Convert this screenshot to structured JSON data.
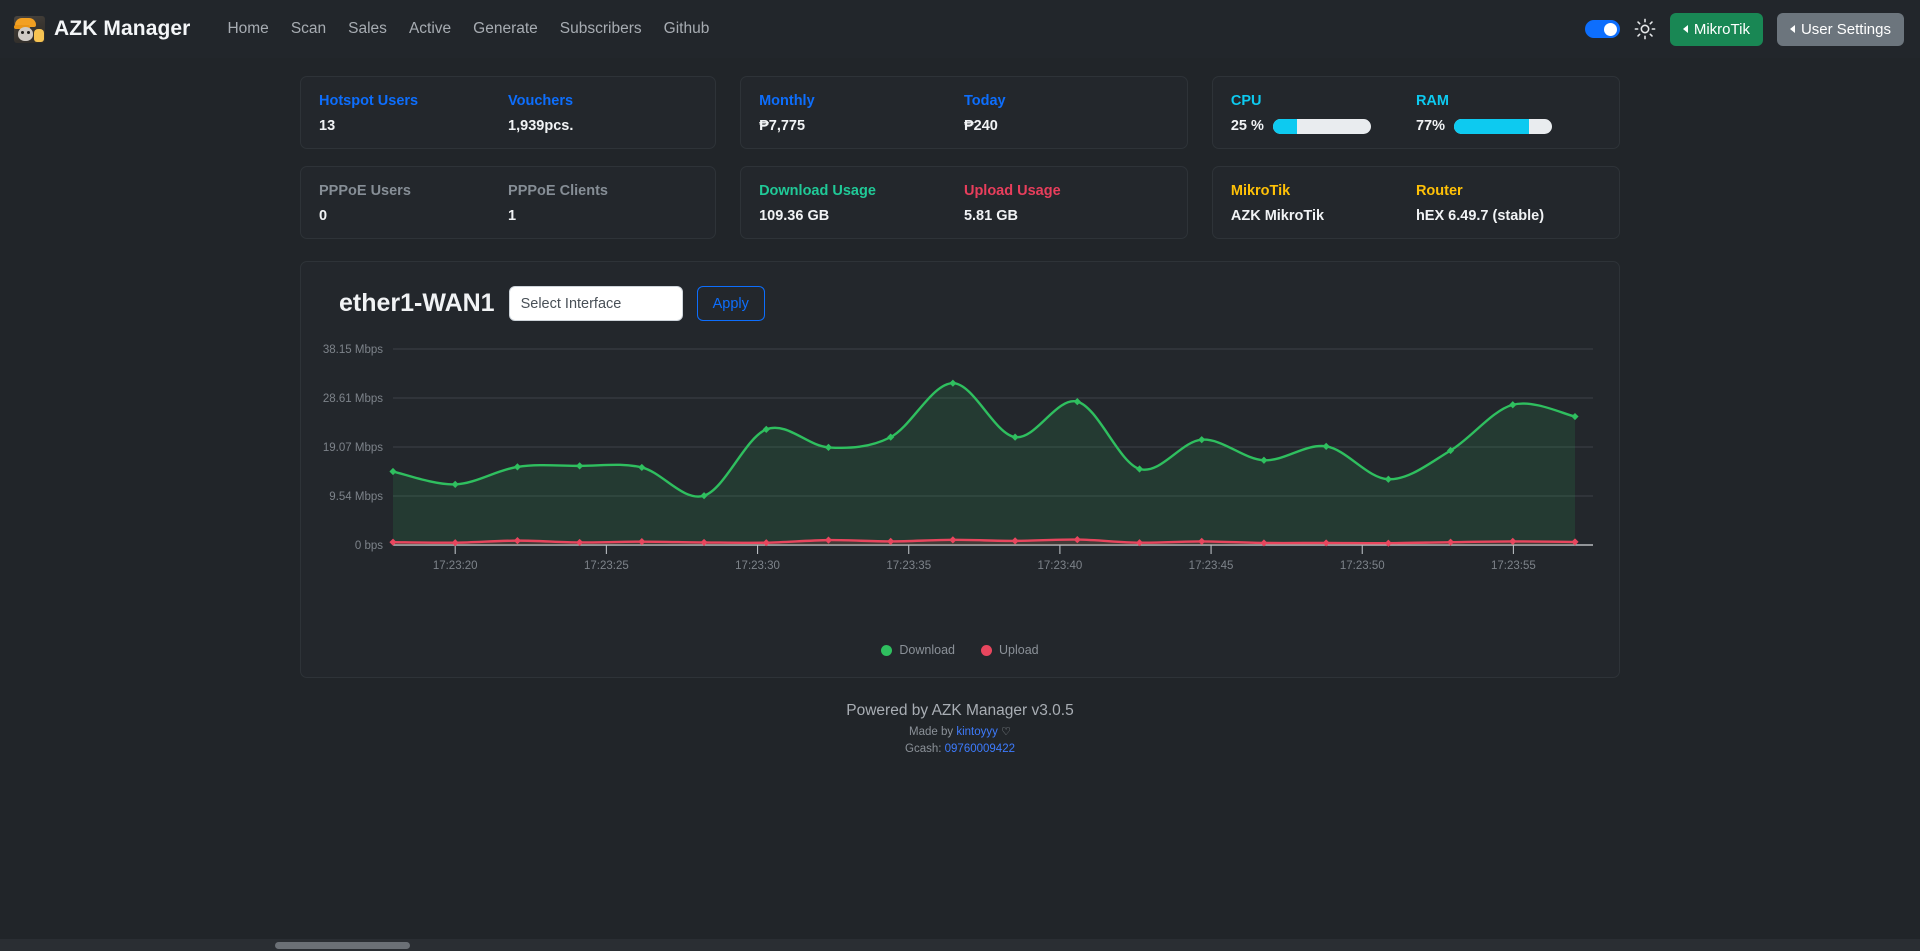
{
  "navbar": {
    "brand": "AZK Manager",
    "logo_icon": "azk-avatar-icon",
    "links": [
      {
        "label": "Home"
      },
      {
        "label": "Scan"
      },
      {
        "label": "Sales"
      },
      {
        "label": "Active"
      },
      {
        "label": "Generate"
      },
      {
        "label": "Subscribers"
      },
      {
        "label": "Github"
      }
    ],
    "theme_toggle": {
      "icon": "toggle-switch-icon",
      "state": "on",
      "color": "#0d6efd"
    },
    "brightness_icon": "sun-icon",
    "mikrotik_button": {
      "label": "MikroTik",
      "color": "#198754",
      "caret": "caret-left-icon"
    },
    "user_settings_button": {
      "label": "User Settings",
      "color": "#6c757d",
      "caret": "caret-left-icon"
    }
  },
  "stats": {
    "hotspot_users": {
      "label": "Hotspot Users",
      "value": "13",
      "color": "#0d6efd"
    },
    "vouchers": {
      "label": "Vouchers",
      "value": "1,939pcs.",
      "color": "#0d6efd"
    },
    "pppoe_users": {
      "label": "PPPoE Users",
      "value": "0",
      "color": "#868e96"
    },
    "pppoe_clients": {
      "label": "PPPoE Clients",
      "value": "1",
      "color": "#868e96"
    },
    "monthly": {
      "label": "Monthly",
      "value": "₱7,775",
      "color": "#0d6efd"
    },
    "today": {
      "label": "Today",
      "value": "₱240",
      "color": "#0d6efd"
    },
    "download_usage": {
      "label": "Download Usage",
      "value": "109.36 GB",
      "color": "#20c997"
    },
    "upload_usage": {
      "label": "Upload Usage",
      "value": "5.81 GB",
      "color": "#e83e5c"
    },
    "cpu": {
      "label": "CPU",
      "value": "25 %",
      "percent": 25,
      "color": "#0dcaf0"
    },
    "ram": {
      "label": "RAM",
      "value": "77%",
      "percent": 77,
      "color": "#0dcaf0"
    },
    "mikrotik": {
      "label": "MikroTik",
      "value": "AZK MikroTik",
      "color": "#ffc107"
    },
    "router": {
      "label": "Router",
      "value": "hEX 6.49.7 (stable)",
      "color": "#ffc107"
    }
  },
  "chart_panel": {
    "title": "ether1-WAN1",
    "select_placeholder": "Select Interface",
    "select_value": "",
    "apply_label": "Apply"
  },
  "chart_data": {
    "type": "area",
    "title": "ether1-WAN1",
    "xlabel": "",
    "ylabel": "",
    "grid": true,
    "legend_position": "bottom",
    "ylim": [
      0,
      38.15
    ],
    "ytick_labels": [
      "38.15 Mbps",
      "28.61 Mbps",
      "19.07 Mbps",
      "9.54 Mbps",
      "0 bps"
    ],
    "ytick_values": [
      38.15,
      28.61,
      19.07,
      9.54,
      0
    ],
    "xtick_labels": [
      "17:23:20",
      "17:23:25",
      "17:23:30",
      "17:23:35",
      "17:23:40",
      "17:23:45",
      "17:23:50",
      "17:23:55"
    ],
    "x": [
      "17:23:18",
      "17:23:20",
      "17:23:22",
      "17:23:24",
      "17:23:26",
      "17:23:29",
      "17:23:31",
      "17:23:33",
      "17:23:35",
      "17:23:37",
      "17:23:39",
      "17:23:41",
      "17:23:43",
      "17:23:45",
      "17:23:47",
      "17:23:49",
      "17:23:52",
      "17:23:54",
      "17:23:56",
      "17:23:58"
    ],
    "series": [
      {
        "name": "Download",
        "color": "#2fbf5f",
        "unit": "Mbps",
        "values": [
          14.3,
          11.8,
          15.2,
          15.4,
          15.1,
          9.6,
          22.5,
          19.0,
          21.0,
          31.5,
          21.0,
          27.9,
          14.8,
          20.5,
          16.5,
          19.2,
          12.8,
          18.4,
          27.3,
          25.0
        ]
      },
      {
        "name": "Upload",
        "color": "#e8465e",
        "unit": "Mbps",
        "values": [
          0.55,
          0.45,
          0.85,
          0.5,
          0.65,
          0.5,
          0.45,
          0.95,
          0.7,
          1.0,
          0.8,
          1.05,
          0.45,
          0.7,
          0.4,
          0.4,
          0.35,
          0.55,
          0.7,
          0.6
        ]
      }
    ],
    "legend": [
      {
        "label": "Download",
        "color": "#2fbf5f"
      },
      {
        "label": "Upload",
        "color": "#e8465e"
      }
    ]
  },
  "footer": {
    "powered_by": "Powered by AZK Manager v3.0.5",
    "made_by_prefix": "Made by ",
    "made_by_name": "kintoyyy",
    "heart": "♡",
    "gcash_label": "Gcash: ",
    "gcash_number": "09760009422"
  }
}
